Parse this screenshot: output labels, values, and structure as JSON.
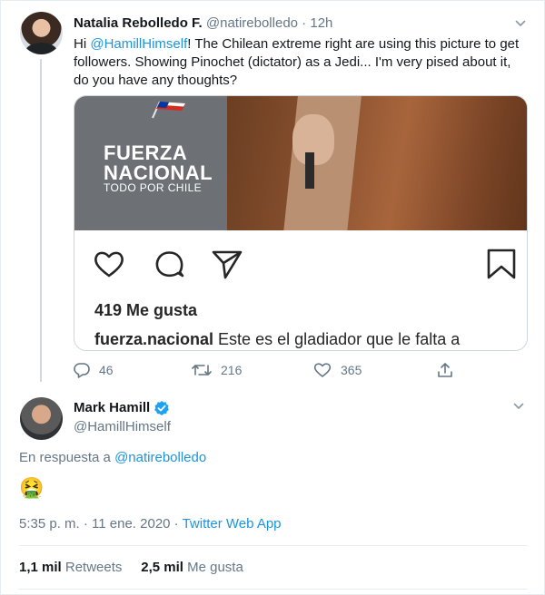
{
  "tweet1": {
    "author_name": "Natalia Rebolledo F.",
    "author_handle": "@natirebolledo",
    "separator": " · ",
    "time": "12h",
    "text_prefix": "Hi ",
    "mention": "@HamillHimself",
    "text_suffix": "! The Chilean extreme right are using this picture to get followers. Showing Pinochet (dictator) as a Jedi... I'm very pised about it, do you have any thoughts?",
    "media": {
      "brand_line1": "FUERZA NACIONAL",
      "brand_line2": "TODO POR CHILE",
      "likes": "419 Me gusta",
      "caption_user": "fuerza.nacional",
      "caption_text": " Este es el gladiador que le falta a"
    },
    "actions": {
      "replies": "46",
      "retweets": "216",
      "likes": "365"
    }
  },
  "tweet2": {
    "author_name": "Mark Hamill",
    "author_handle": "@HamillHimself",
    "reply_prefix": "En respuesta a ",
    "reply_mention": "@natirebolledo",
    "emoji": "🤮",
    "timestamp": "5:35 p. m. · 11 ene. 2020 · ",
    "source": "Twitter Web App",
    "retweets_count": "1,1 mil",
    "retweets_label": " Retweets",
    "likes_count": "2,5 mil",
    "likes_label": " Me gusta"
  },
  "colors": {
    "link": "#1b95e0",
    "secondary_text": "#657786",
    "verified": "#1da1f2",
    "border": "#e6ecf0"
  }
}
